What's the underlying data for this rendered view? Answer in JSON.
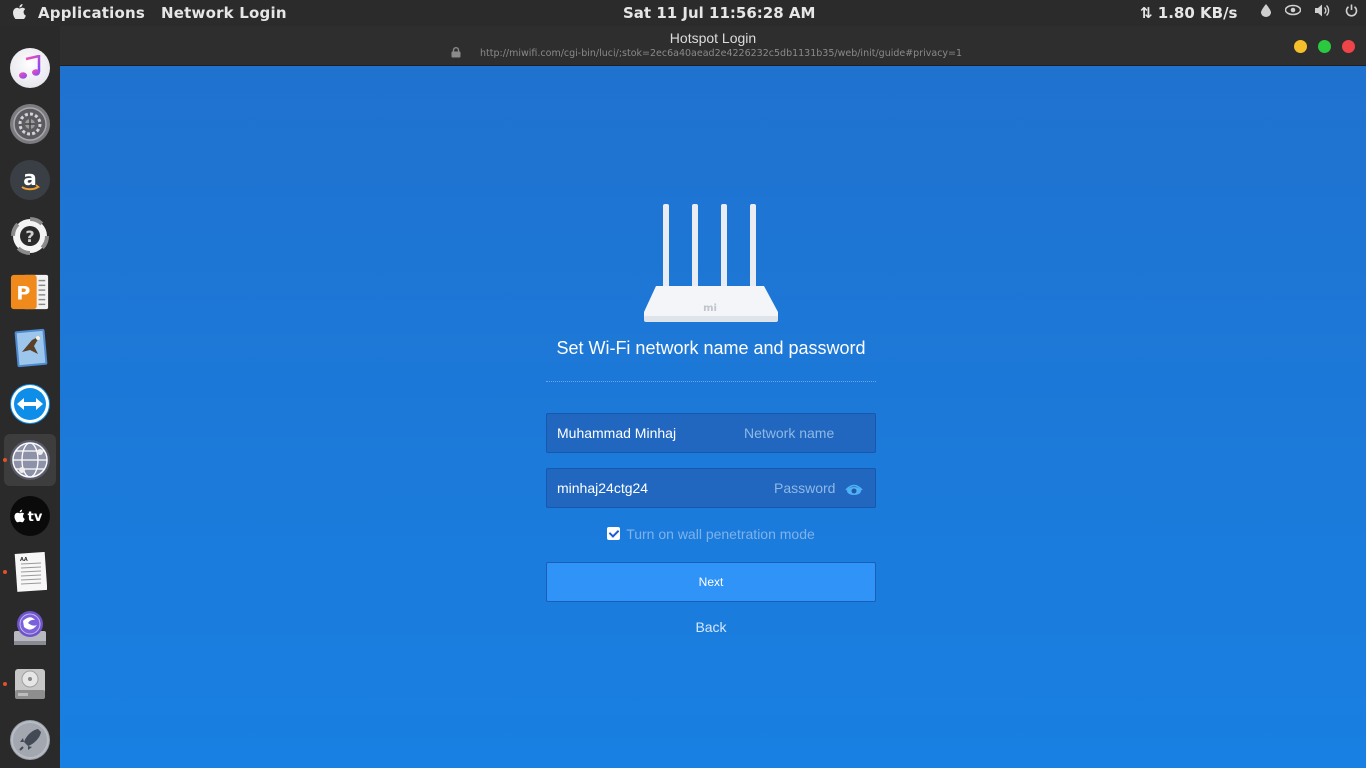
{
  "topbar": {
    "apple_icon": "apple-logo",
    "menu": [
      "Applications",
      "Network Login"
    ],
    "clock": "Sat 11 Jul  11:56:28 AM",
    "net_speed": "⇅ 1.80 KB/s",
    "tray_icons": [
      "drop-icon",
      "eye-icon",
      "volume-icon",
      "power-icon"
    ]
  },
  "dock": {
    "apps": [
      "itunes-icon",
      "system-preferences-icon",
      "amazon-icon",
      "help-lifebuoy-icon",
      "presentation-app-icon",
      "preview-eagle-icon",
      "teamviewer-icon",
      "network-globe-icon",
      "apple-tv-icon",
      "text-document-icon",
      "disk-utility-icon",
      "hard-drive-icon",
      "launchpad-rocket-icon"
    ]
  },
  "window": {
    "title": "Hotspot Login",
    "url": "http://miwifi.com/cgi-bin/luci/;stok=2ec6a40aead2e4226232c5db1131b35/web/init/guide#privacy=1"
  },
  "form": {
    "router_logo": "mi",
    "heading": "Set Wi-Fi network name and password",
    "network_value": "Muhammad Minhaj",
    "network_placeholder": "Network name",
    "password_value": "minhaj24ctg24",
    "password_placeholder": "Password",
    "wall_mode_label": "Turn on wall penetration mode",
    "wall_mode_checked": true,
    "next_label": "Next",
    "back_label": "Back"
  },
  "colors": {
    "background": "#1a7ad9",
    "button": "#2f93f7",
    "field": "#2167bf"
  }
}
